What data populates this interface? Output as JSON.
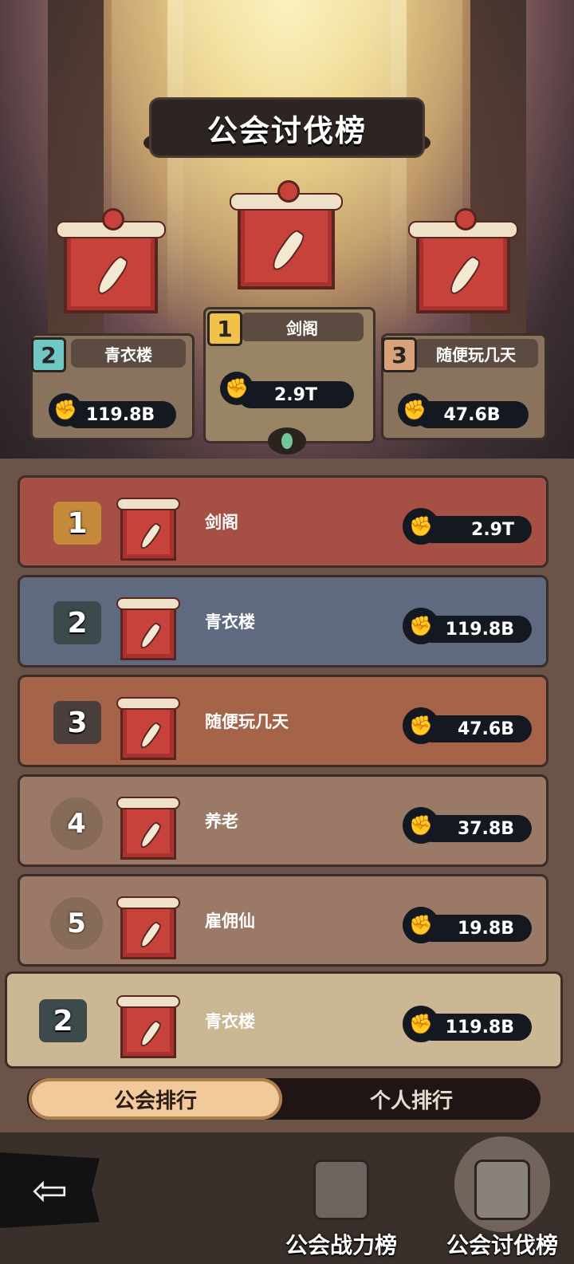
{
  "title": "公会讨伐榜",
  "podium": [
    {
      "rank": "2",
      "name": "青衣楼",
      "value": "119.8B",
      "badge_color": "#6fc7c6"
    },
    {
      "rank": "1",
      "name": "剑阁",
      "value": "2.9T",
      "badge_color": "#f0c24a"
    },
    {
      "rank": "3",
      "name": "随便玩几天",
      "value": "47.6B",
      "badge_color": "#d9a27a"
    }
  ],
  "list": [
    {
      "rank": "1",
      "name": "剑阁",
      "value": "2.9T",
      "color": "#a54f45"
    },
    {
      "rank": "2",
      "name": "青衣楼",
      "value": "119.8B",
      "color": "#5f6a80"
    },
    {
      "rank": "3",
      "name": "随便玩几天",
      "value": "47.6B",
      "color": "#a5644a"
    },
    {
      "rank": "4",
      "name": "养老",
      "value": "37.8B",
      "color": "#9a7a66"
    },
    {
      "rank": "5",
      "name": "雇佣仙",
      "value": "19.8B",
      "color": "#9a7a66"
    }
  ],
  "my_guild": {
    "rank": "2",
    "name": "青衣楼",
    "value": "119.8B",
    "color": "#cbb793"
  },
  "tabs": {
    "guild": "公会排行",
    "personal": "个人排行"
  },
  "nav": {
    "power": "公会战力榜",
    "raid": "公会讨伐榜"
  },
  "icons": {
    "power": "fist-icon",
    "back": "back-arrow-icon"
  }
}
